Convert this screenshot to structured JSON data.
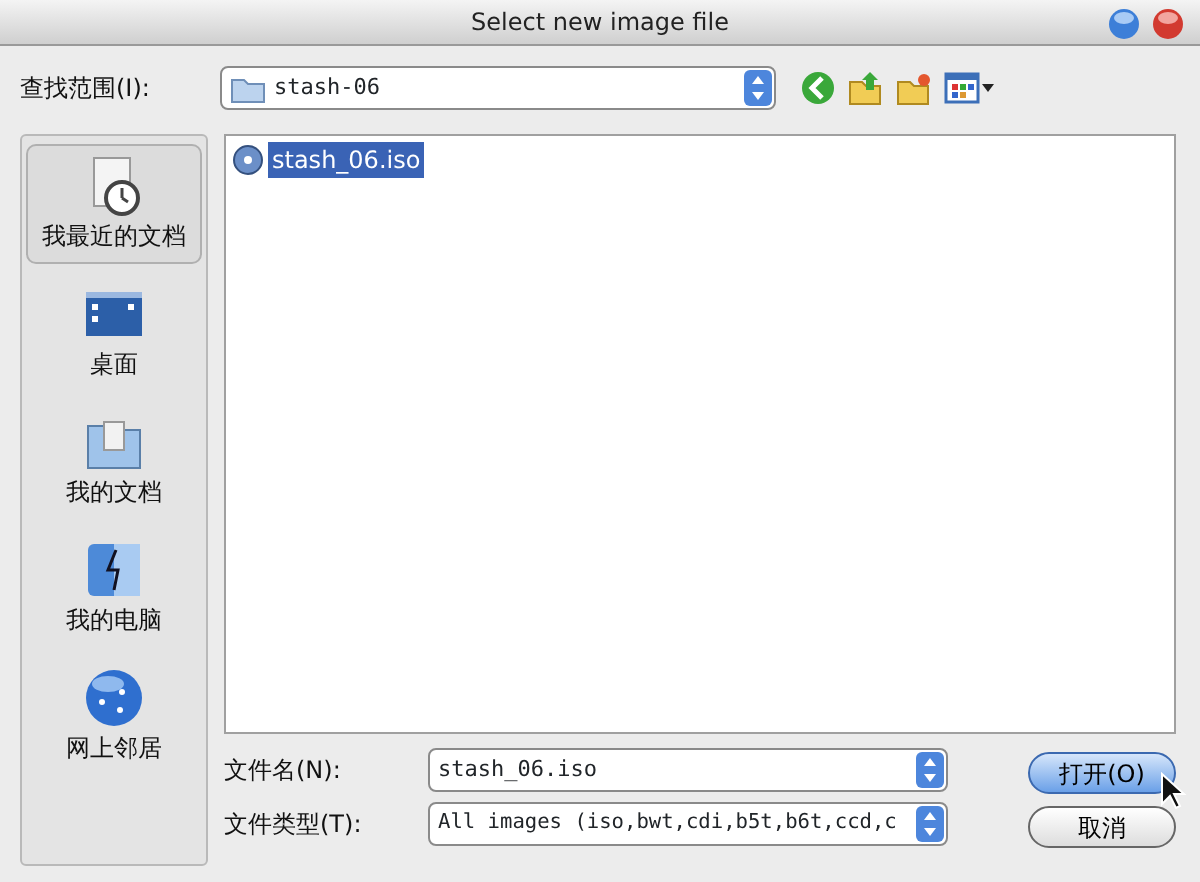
{
  "window": {
    "title": "Select new image file"
  },
  "look_in": {
    "label": "查找范围(I):",
    "value": "stash-06"
  },
  "places": [
    {
      "label": "我最近的文档",
      "kind": "recent",
      "selected": true
    },
    {
      "label": "桌面",
      "kind": "desktop",
      "selected": false
    },
    {
      "label": "我的文档",
      "kind": "documents",
      "selected": false
    },
    {
      "label": "我的电脑",
      "kind": "computer",
      "selected": false
    },
    {
      "label": "网上邻居",
      "kind": "network",
      "selected": false
    }
  ],
  "files": [
    {
      "name": "stash_06.iso",
      "selected": true
    }
  ],
  "file_name": {
    "label": "文件名(N):",
    "value": "stash_06.iso"
  },
  "file_type": {
    "label": "文件类型(T):",
    "value": "All images (iso,bwt,cdi,b5t,b6t,ccd,c"
  },
  "buttons": [
    {
      "label": "打开(O)",
      "kind": "default"
    },
    {
      "label": "取消",
      "kind": "normal"
    }
  ]
}
